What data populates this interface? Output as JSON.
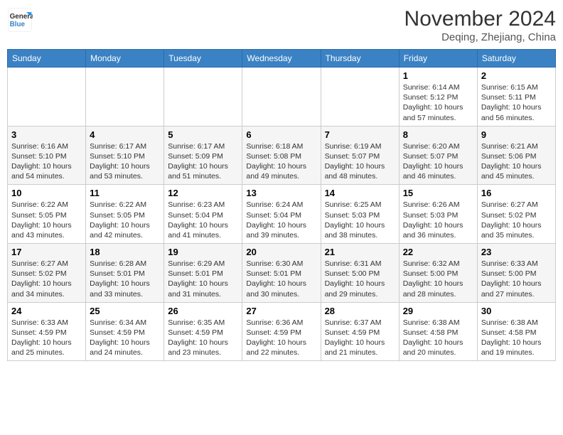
{
  "header": {
    "logo_line1": "General",
    "logo_line2": "Blue",
    "month_year": "November 2024",
    "location": "Deqing, Zhejiang, China"
  },
  "weekdays": [
    "Sunday",
    "Monday",
    "Tuesday",
    "Wednesday",
    "Thursday",
    "Friday",
    "Saturday"
  ],
  "weeks": [
    [
      {
        "day": "",
        "info": ""
      },
      {
        "day": "",
        "info": ""
      },
      {
        "day": "",
        "info": ""
      },
      {
        "day": "",
        "info": ""
      },
      {
        "day": "",
        "info": ""
      },
      {
        "day": "1",
        "info": "Sunrise: 6:14 AM\nSunset: 5:12 PM\nDaylight: 10 hours\nand 57 minutes."
      },
      {
        "day": "2",
        "info": "Sunrise: 6:15 AM\nSunset: 5:11 PM\nDaylight: 10 hours\nand 56 minutes."
      }
    ],
    [
      {
        "day": "3",
        "info": "Sunrise: 6:16 AM\nSunset: 5:10 PM\nDaylight: 10 hours\nand 54 minutes."
      },
      {
        "day": "4",
        "info": "Sunrise: 6:17 AM\nSunset: 5:10 PM\nDaylight: 10 hours\nand 53 minutes."
      },
      {
        "day": "5",
        "info": "Sunrise: 6:17 AM\nSunset: 5:09 PM\nDaylight: 10 hours\nand 51 minutes."
      },
      {
        "day": "6",
        "info": "Sunrise: 6:18 AM\nSunset: 5:08 PM\nDaylight: 10 hours\nand 49 minutes."
      },
      {
        "day": "7",
        "info": "Sunrise: 6:19 AM\nSunset: 5:07 PM\nDaylight: 10 hours\nand 48 minutes."
      },
      {
        "day": "8",
        "info": "Sunrise: 6:20 AM\nSunset: 5:07 PM\nDaylight: 10 hours\nand 46 minutes."
      },
      {
        "day": "9",
        "info": "Sunrise: 6:21 AM\nSunset: 5:06 PM\nDaylight: 10 hours\nand 45 minutes."
      }
    ],
    [
      {
        "day": "10",
        "info": "Sunrise: 6:22 AM\nSunset: 5:05 PM\nDaylight: 10 hours\nand 43 minutes."
      },
      {
        "day": "11",
        "info": "Sunrise: 6:22 AM\nSunset: 5:05 PM\nDaylight: 10 hours\nand 42 minutes."
      },
      {
        "day": "12",
        "info": "Sunrise: 6:23 AM\nSunset: 5:04 PM\nDaylight: 10 hours\nand 41 minutes."
      },
      {
        "day": "13",
        "info": "Sunrise: 6:24 AM\nSunset: 5:04 PM\nDaylight: 10 hours\nand 39 minutes."
      },
      {
        "day": "14",
        "info": "Sunrise: 6:25 AM\nSunset: 5:03 PM\nDaylight: 10 hours\nand 38 minutes."
      },
      {
        "day": "15",
        "info": "Sunrise: 6:26 AM\nSunset: 5:03 PM\nDaylight: 10 hours\nand 36 minutes."
      },
      {
        "day": "16",
        "info": "Sunrise: 6:27 AM\nSunset: 5:02 PM\nDaylight: 10 hours\nand 35 minutes."
      }
    ],
    [
      {
        "day": "17",
        "info": "Sunrise: 6:27 AM\nSunset: 5:02 PM\nDaylight: 10 hours\nand 34 minutes."
      },
      {
        "day": "18",
        "info": "Sunrise: 6:28 AM\nSunset: 5:01 PM\nDaylight: 10 hours\nand 33 minutes."
      },
      {
        "day": "19",
        "info": "Sunrise: 6:29 AM\nSunset: 5:01 PM\nDaylight: 10 hours\nand 31 minutes."
      },
      {
        "day": "20",
        "info": "Sunrise: 6:30 AM\nSunset: 5:01 PM\nDaylight: 10 hours\nand 30 minutes."
      },
      {
        "day": "21",
        "info": "Sunrise: 6:31 AM\nSunset: 5:00 PM\nDaylight: 10 hours\nand 29 minutes."
      },
      {
        "day": "22",
        "info": "Sunrise: 6:32 AM\nSunset: 5:00 PM\nDaylight: 10 hours\nand 28 minutes."
      },
      {
        "day": "23",
        "info": "Sunrise: 6:33 AM\nSunset: 5:00 PM\nDaylight: 10 hours\nand 27 minutes."
      }
    ],
    [
      {
        "day": "24",
        "info": "Sunrise: 6:33 AM\nSunset: 4:59 PM\nDaylight: 10 hours\nand 25 minutes."
      },
      {
        "day": "25",
        "info": "Sunrise: 6:34 AM\nSunset: 4:59 PM\nDaylight: 10 hours\nand 24 minutes."
      },
      {
        "day": "26",
        "info": "Sunrise: 6:35 AM\nSunset: 4:59 PM\nDaylight: 10 hours\nand 23 minutes."
      },
      {
        "day": "27",
        "info": "Sunrise: 6:36 AM\nSunset: 4:59 PM\nDaylight: 10 hours\nand 22 minutes."
      },
      {
        "day": "28",
        "info": "Sunrise: 6:37 AM\nSunset: 4:59 PM\nDaylight: 10 hours\nand 21 minutes."
      },
      {
        "day": "29",
        "info": "Sunrise: 6:38 AM\nSunset: 4:58 PM\nDaylight: 10 hours\nand 20 minutes."
      },
      {
        "day": "30",
        "info": "Sunrise: 6:38 AM\nSunset: 4:58 PM\nDaylight: 10 hours\nand 19 minutes."
      }
    ]
  ]
}
